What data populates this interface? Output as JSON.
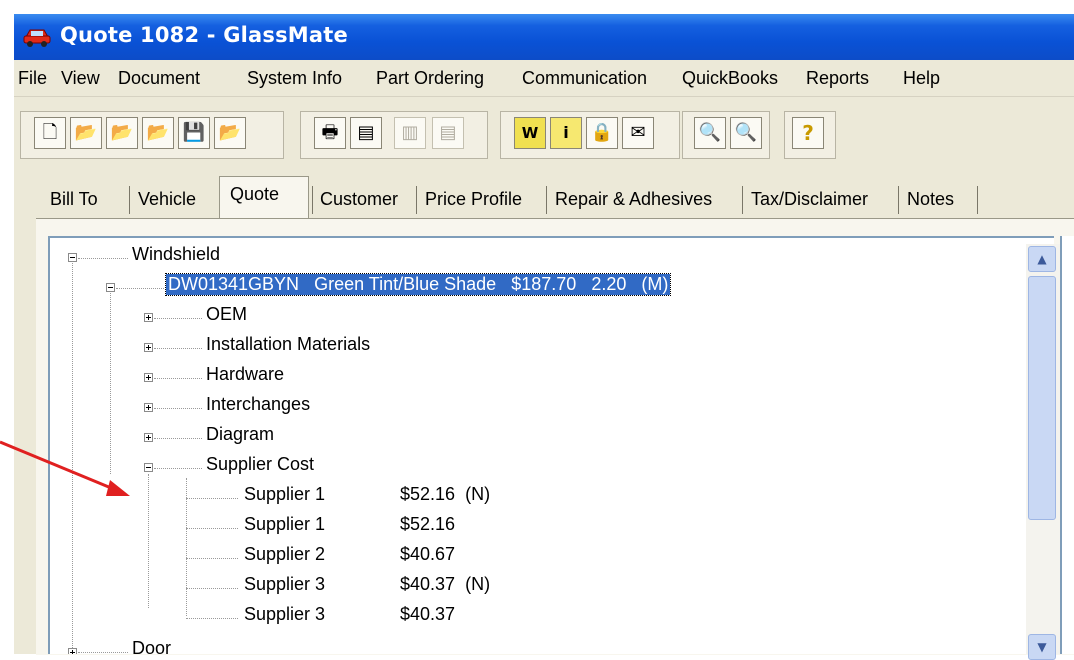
{
  "window": {
    "title": "Quote 1082 - GlassMate"
  },
  "menu": [
    {
      "label": "File"
    },
    {
      "label": "View"
    },
    {
      "label": "Document"
    },
    {
      "label": "System Info"
    },
    {
      "label": "Part Ordering"
    },
    {
      "label": "Communication"
    },
    {
      "label": "QuickBooks"
    },
    {
      "label": "Reports"
    },
    {
      "label": "Help"
    }
  ],
  "toolbar": {
    "buttons": [
      {
        "icon": "new-document-icon",
        "glyph": "🗋"
      },
      {
        "icon": "open-folder-icon",
        "glyph": "📂"
      },
      {
        "icon": "open-folder-alt-icon",
        "glyph": "📂"
      },
      {
        "icon": "open-folder-green-icon",
        "glyph": "📂"
      },
      {
        "icon": "save-icon",
        "glyph": "💾"
      },
      {
        "icon": "open-save-icon",
        "glyph": "📂"
      },
      {
        "icon": "print-icon",
        "glyph": "🖶"
      },
      {
        "icon": "form-icon",
        "glyph": "▤"
      },
      {
        "icon": "fax-disabled-icon",
        "glyph": "▥"
      },
      {
        "icon": "report-disabled-icon",
        "glyph": "▤"
      },
      {
        "icon": "word-doc-icon",
        "glyph": "W"
      },
      {
        "icon": "info-icon",
        "glyph": "i"
      },
      {
        "icon": "lock-icon",
        "glyph": "🔒"
      },
      {
        "icon": "mailbox-icon",
        "glyph": "✉"
      },
      {
        "icon": "search-list-icon",
        "glyph": "🔍"
      },
      {
        "icon": "magnifier-icon",
        "glyph": "🔍"
      },
      {
        "icon": "help-icon",
        "glyph": "?"
      }
    ]
  },
  "tabs": [
    {
      "label": "Bill To"
    },
    {
      "label": "Vehicle"
    },
    {
      "label": "Quote"
    },
    {
      "label": "Customer"
    },
    {
      "label": "Price Profile"
    },
    {
      "label": "Repair & Adhesives"
    },
    {
      "label": "Tax/Disclaimer"
    },
    {
      "label": "Notes"
    }
  ],
  "tree": {
    "root": "Windshield",
    "part": {
      "number": "DW01341GBYN",
      "description": "Green Tint/Blue Shade",
      "price": "$187.70",
      "hours": "2.20",
      "flag": "(M)"
    },
    "children": [
      {
        "label": "OEM"
      },
      {
        "label": "Installation Materials"
      },
      {
        "label": "Hardware"
      },
      {
        "label": "Interchanges"
      },
      {
        "label": "Diagram"
      },
      {
        "label": "Supplier Cost"
      }
    ],
    "suppliers": [
      {
        "name": "Supplier 1",
        "cost": "$52.16",
        "flag": "(N)"
      },
      {
        "name": "Supplier 1",
        "cost": "$52.16",
        "flag": ""
      },
      {
        "name": "Supplier 2",
        "cost": "$40.67",
        "flag": ""
      },
      {
        "name": "Supplier 3",
        "cost": "$40.37",
        "flag": "(N)"
      },
      {
        "name": "Supplier 3",
        "cost": "$40.37",
        "flag": ""
      }
    ],
    "next_root": "Door"
  },
  "colors": {
    "titlebar": "#0a52d6",
    "selection": "#316ac5",
    "annotation_arrow": "#e02020"
  }
}
